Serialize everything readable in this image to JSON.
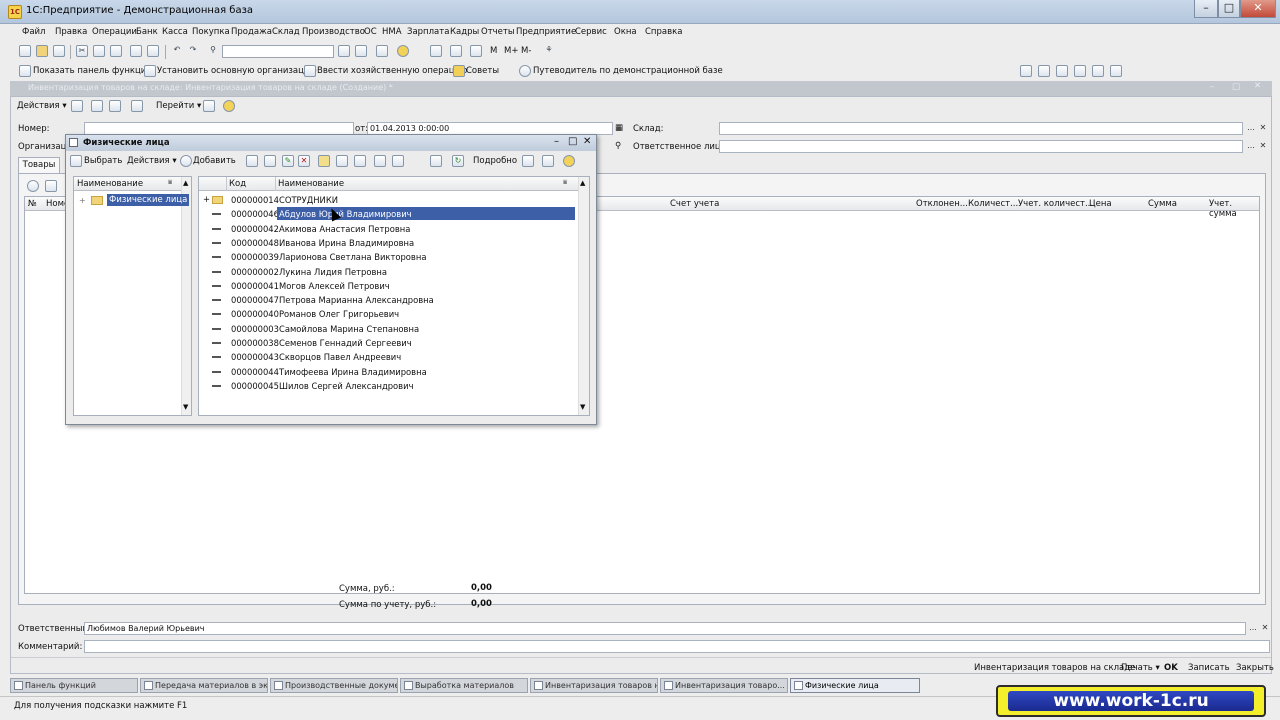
{
  "window": {
    "title": "1С:Предприятие - Демонстрационная база",
    "app_icon": "1С"
  },
  "menu": [
    "Файл",
    "Правка",
    "Операции",
    "Банк",
    "Касса",
    "Покупка",
    "Продажа",
    "Склад",
    "Производство",
    "ОС",
    "НМА",
    "Зарплата",
    "Кадры",
    "Отчеты",
    "Предприятие",
    "Сервис",
    "Окна",
    "Справка"
  ],
  "toolbar2": {
    "show_panel": "Показать панель функций",
    "set_org": "Установить основную организацию",
    "enter_op": "Ввести хозяйственную операцию",
    "tips": "Советы",
    "guide": "Путеводитель по демонстрационной базе"
  },
  "document": {
    "title": "Инвентаризация товаров на складе: Инвентаризация товаров на складе (Создание) *",
    "actions": "Действия",
    "goto": "Перейти",
    "number_label": "Номер:",
    "date_label": "от:",
    "date_value": "01.04.2013  0:00:00",
    "warehouse_label": "Склад:",
    "org_label": "Организация:",
    "resp_person_label": "Ответственное лицо:",
    "tab_goods": "Товары",
    "columns": [
      "№",
      "Номенклатура",
      "Счет учета",
      "Отклонен...",
      "Количест...",
      "Учет. количест...",
      "Цена",
      "Сумма",
      "Учет. сумма"
    ],
    "sum_label": "Сумма, руб.:",
    "sum_value": "0,00",
    "sum_acc_label": "Сумма по учету, руб.:",
    "sum_acc_value": "0,00",
    "responsible_label": "Ответственный:",
    "responsible_value": "Любимов Валерий Юрьевич",
    "comment_label": "Комментарий:",
    "footer_doc": "Инвентаризация товаров на складе",
    "print": "Печать",
    "ok": "OK",
    "save": "Записать",
    "close": "Закрыть"
  },
  "popup": {
    "title": "Физические лица",
    "select": "Выбрать",
    "actions": "Действия",
    "add": "Добавить",
    "details": "Подробно",
    "tree_header": "Наименование",
    "tree_root": "Физические лица",
    "col_code": "Код",
    "col_name": "Наименование",
    "rows": [
      {
        "code": "000000014",
        "name": "СОТРУДНИКИ",
        "folder": true
      },
      {
        "code": "000000046",
        "name": "Абдулов Юрий Владимирович",
        "selected": true
      },
      {
        "code": "000000042",
        "name": "Акимова Анастасия Петровна"
      },
      {
        "code": "000000048",
        "name": "Иванова Ирина Владимировна"
      },
      {
        "code": "000000039",
        "name": "Ларионова Светлана Викторовна"
      },
      {
        "code": "000000002",
        "name": "Лукина  Лидия Петровна"
      },
      {
        "code": "000000041",
        "name": "Могов Алексей Петрович"
      },
      {
        "code": "000000047",
        "name": "Петрова Марианна Александровна"
      },
      {
        "code": "000000040",
        "name": "Романов Олег Григорьевич"
      },
      {
        "code": "000000003",
        "name": "Самойлова Марина Степановна"
      },
      {
        "code": "000000038",
        "name": "Семенов Геннадий Сергеевич"
      },
      {
        "code": "000000043",
        "name": "Скворцов Павел Андреевич"
      },
      {
        "code": "000000044",
        "name": "Тимофеева Ирина Владимировна"
      },
      {
        "code": "000000045",
        "name": "Шилов Сергей Александрович"
      }
    ]
  },
  "taskbar": [
    "Панель функций",
    "Передача материалов в эк...",
    "Производственные докуме...",
    "Выработка материалов",
    "Инвентаризация товаров н...",
    "Инвентаризация товаро...",
    "Физические лица"
  ],
  "status": "Для получения подсказки нажмите F1",
  "watermark": "www.work-1c.ru",
  "colors": {
    "selection": "#3d5fa8",
    "logo_bg": "#f3ef2a",
    "logo_text_bg": "#1a2a8e"
  }
}
